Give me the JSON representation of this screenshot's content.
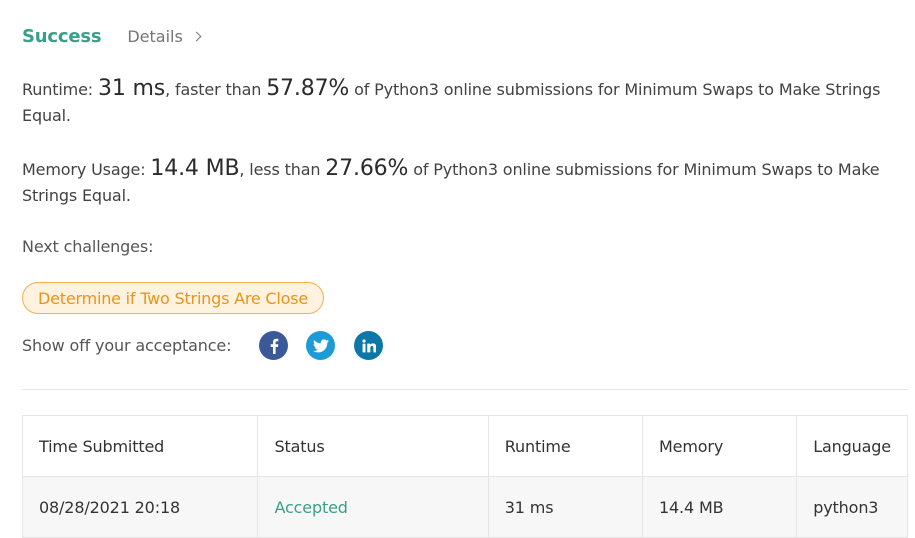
{
  "result": {
    "status": "Success",
    "details_label": "Details"
  },
  "runtime": {
    "label": "Runtime:",
    "value": "31 ms",
    "comparison": ", faster than",
    "percent": "57.87%",
    "suffix": "of Python3 online submissions for Minimum Swaps to Make Strings Equal."
  },
  "memory": {
    "label": "Memory Usage:",
    "value": "14.4 MB",
    "comparison": ", less than",
    "percent": "27.66%",
    "suffix": "of Python3 online submissions for Minimum Swaps to Make Strings Equal."
  },
  "next": {
    "label": "Next challenges:",
    "challenge": "Determine if Two Strings Are Close"
  },
  "share": {
    "label": "Show off your acceptance:",
    "icons": [
      "facebook-icon",
      "twitter-icon",
      "linkedin-icon"
    ]
  },
  "colors": {
    "success": "#3a9f8a",
    "challenge_text": "#e9951b",
    "challenge_bg": "#fff2de",
    "facebook": "#3b5998",
    "twitter": "#1d9bd7",
    "linkedin": "#0d77a7"
  },
  "table": {
    "headers": [
      "Time Submitted",
      "Status",
      "Runtime",
      "Memory",
      "Language"
    ],
    "rows": [
      [
        "08/28/2021 20:18",
        "Accepted",
        "31 ms",
        "14.4 MB",
        "python3"
      ]
    ]
  }
}
